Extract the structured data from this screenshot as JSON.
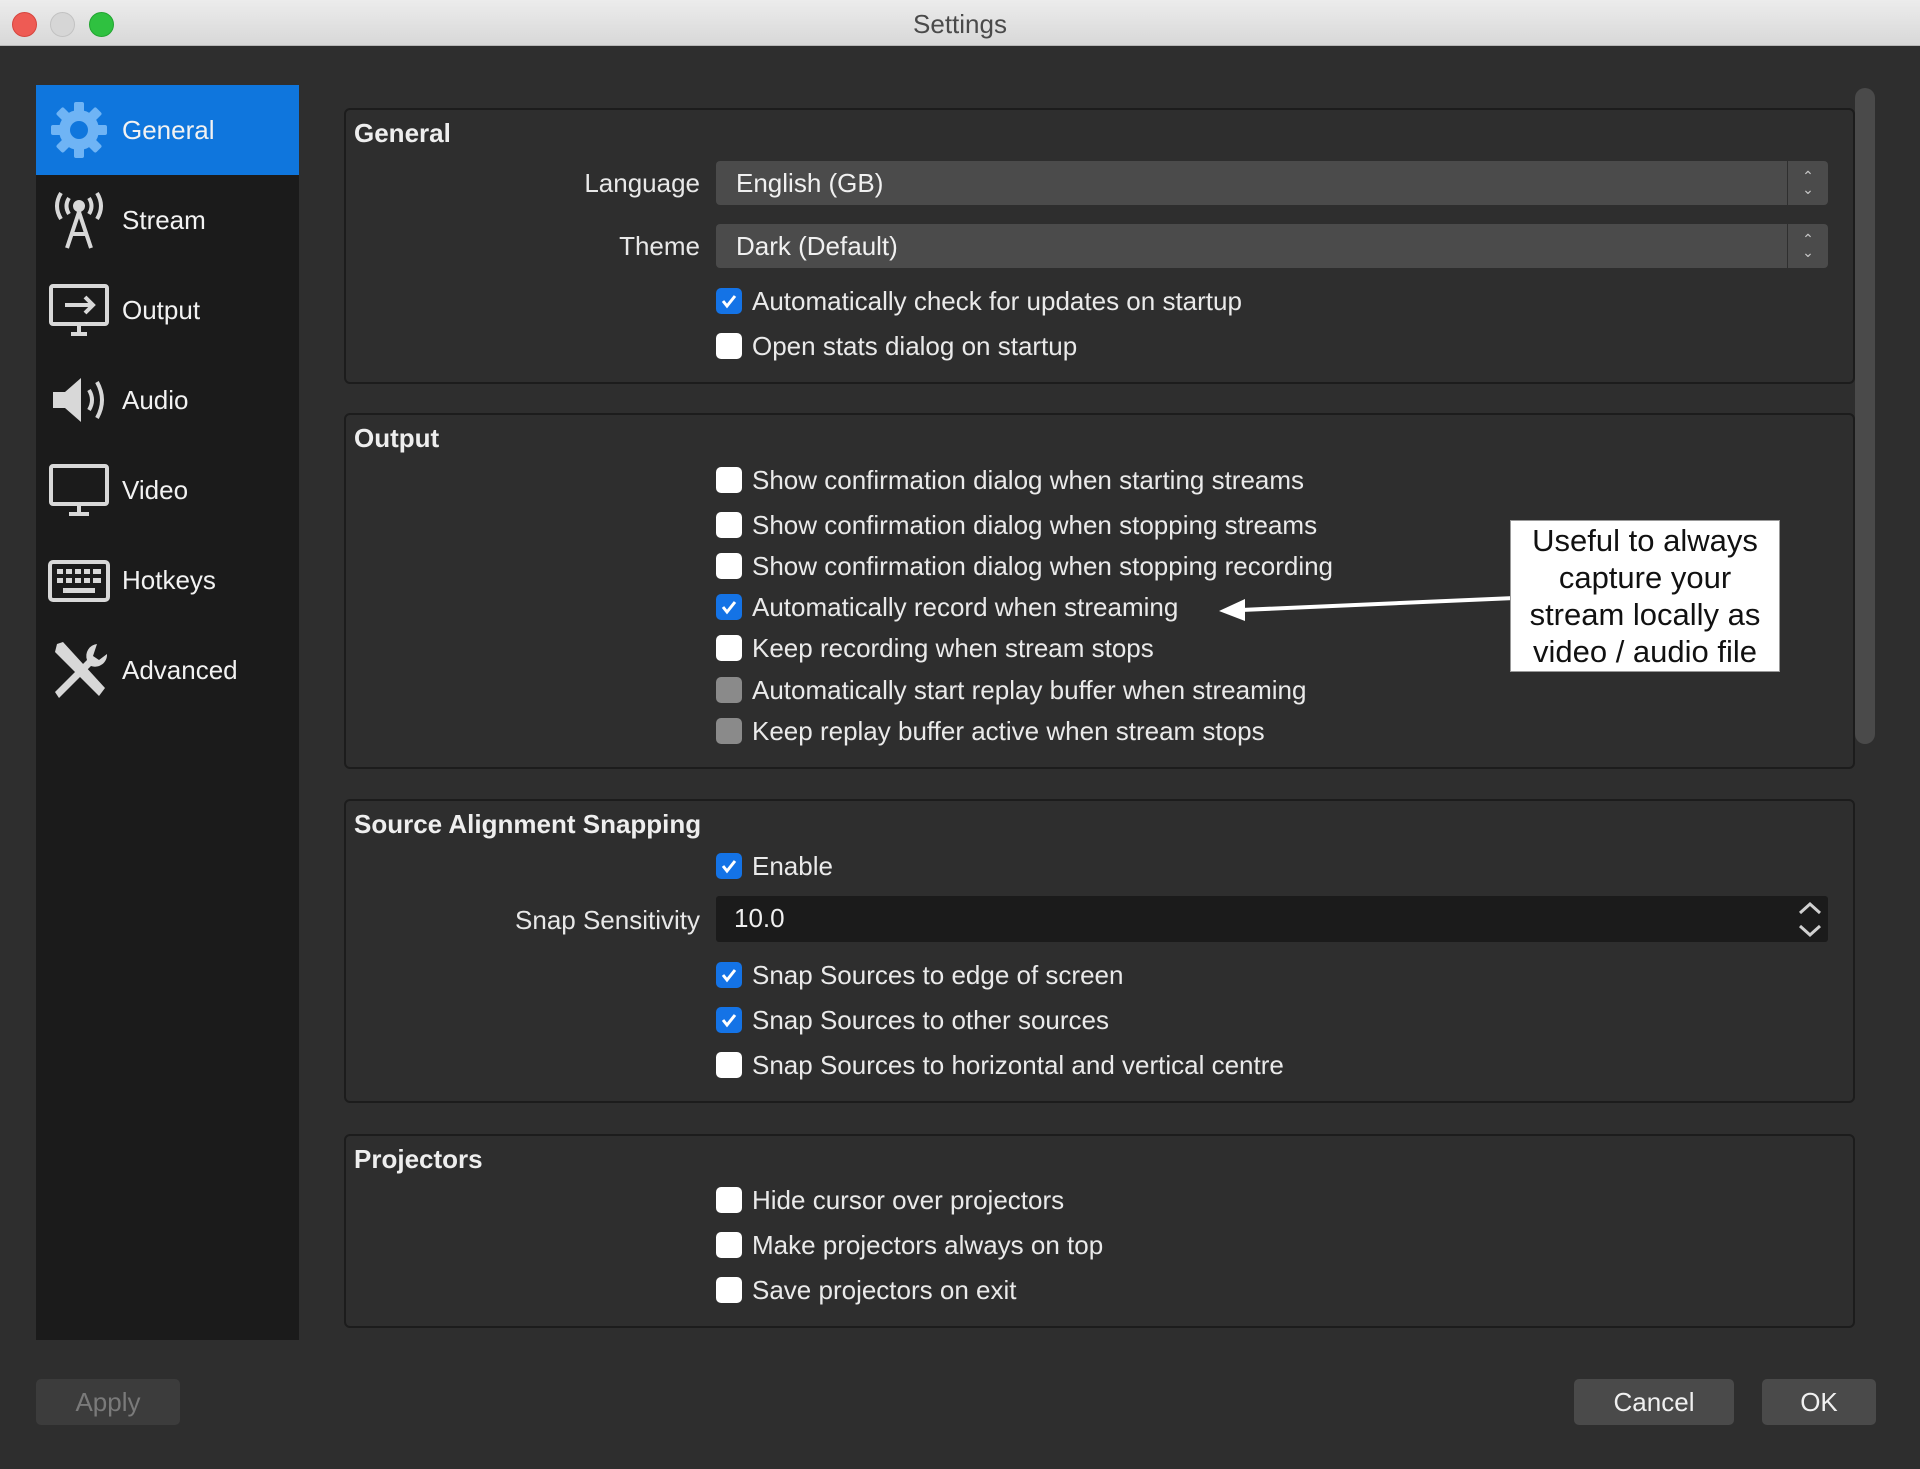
{
  "window": {
    "title": "Settings"
  },
  "sidebar": {
    "items": [
      {
        "label": "General",
        "icon": "gear-icon",
        "active": true
      },
      {
        "label": "Stream",
        "icon": "antenna-icon"
      },
      {
        "label": "Output",
        "icon": "output-icon"
      },
      {
        "label": "Audio",
        "icon": "speaker-icon"
      },
      {
        "label": "Video",
        "icon": "monitor-icon"
      },
      {
        "label": "Hotkeys",
        "icon": "keyboard-icon"
      },
      {
        "label": "Advanced",
        "icon": "wrench-screwdriver-icon"
      }
    ]
  },
  "general": {
    "title": "General",
    "language_label": "Language",
    "language_value": "English (GB)",
    "theme_label": "Theme",
    "theme_value": "Dark (Default)",
    "checks": [
      {
        "label": "Automatically check for updates on startup",
        "checked": true
      },
      {
        "label": "Open stats dialog on startup",
        "checked": false
      }
    ]
  },
  "output": {
    "title": "Output",
    "checks": [
      {
        "label": "Show confirmation dialog when starting streams",
        "checked": false
      },
      {
        "label": "Show confirmation dialog when stopping streams",
        "checked": false
      },
      {
        "label": "Show confirmation dialog when stopping recording",
        "checked": false
      },
      {
        "label": "Automatically record when streaming",
        "checked": true
      },
      {
        "label": "Keep recording when stream stops",
        "checked": false
      },
      {
        "label": "Automatically start replay buffer when streaming",
        "checked": false,
        "disabled": true
      },
      {
        "label": "Keep replay buffer active when stream stops",
        "checked": false,
        "disabled": true
      }
    ]
  },
  "snapping": {
    "title": "Source Alignment Snapping",
    "enable": {
      "label": "Enable",
      "checked": true
    },
    "sensitivity_label": "Snap Sensitivity",
    "sensitivity_value": "10.0",
    "checks": [
      {
        "label": "Snap Sources to edge of screen",
        "checked": true
      },
      {
        "label": "Snap Sources to other sources",
        "checked": true
      },
      {
        "label": "Snap Sources to horizontal and vertical centre",
        "checked": false
      }
    ]
  },
  "projectors": {
    "title": "Projectors",
    "checks": [
      {
        "label": "Hide cursor over projectors",
        "checked": false
      },
      {
        "label": "Make projectors always on top",
        "checked": false
      },
      {
        "label": "Save projectors on exit",
        "checked": false
      }
    ]
  },
  "callout": {
    "text": "Useful to always\ncapture your\nstream locally as\nvideo / audio file"
  },
  "buttons": {
    "apply": "Apply",
    "cancel": "Cancel",
    "ok": "OK"
  },
  "colors": {
    "accent": "#0f76dd",
    "checkbox_on": "#1473e6",
    "background": "#2e2e2e",
    "sidebar": "#1b1b1b"
  }
}
